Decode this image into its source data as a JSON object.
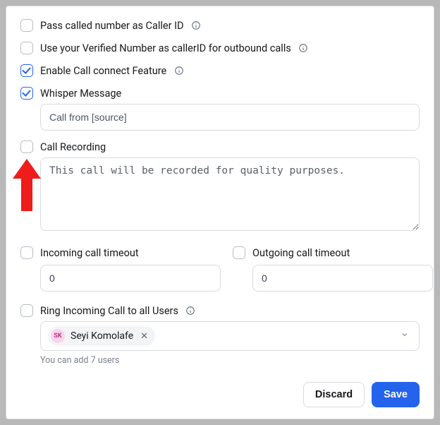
{
  "options": {
    "pass_caller_id": {
      "label": "Pass called number as Caller ID",
      "checked": false
    },
    "verified_number": {
      "label": "Use your Verified Number as callerID for outbound calls",
      "checked": false
    },
    "call_connect": {
      "label": "Enable Call connect Feature",
      "checked": true
    },
    "whisper": {
      "label": "Whisper Message",
      "checked": true,
      "value": "Call from [source]"
    },
    "recording": {
      "label": "Call Recording",
      "checked": false,
      "value": "This call will be recorded for quality purposes."
    },
    "incoming_timeout": {
      "label": "Incoming call timeout",
      "checked": false,
      "value": "0"
    },
    "outgoing_timeout": {
      "label": "Outgoing call timeout",
      "checked": false,
      "value": "0"
    },
    "ring_all": {
      "label": "Ring Incoming Call to all Users",
      "checked": false
    }
  },
  "user_select": {
    "chip_initials": "SK",
    "chip_name": "Seyi Komolafe",
    "hint": "You can add 7 users"
  },
  "buttons": {
    "discard": "Discard",
    "save": "Save"
  }
}
